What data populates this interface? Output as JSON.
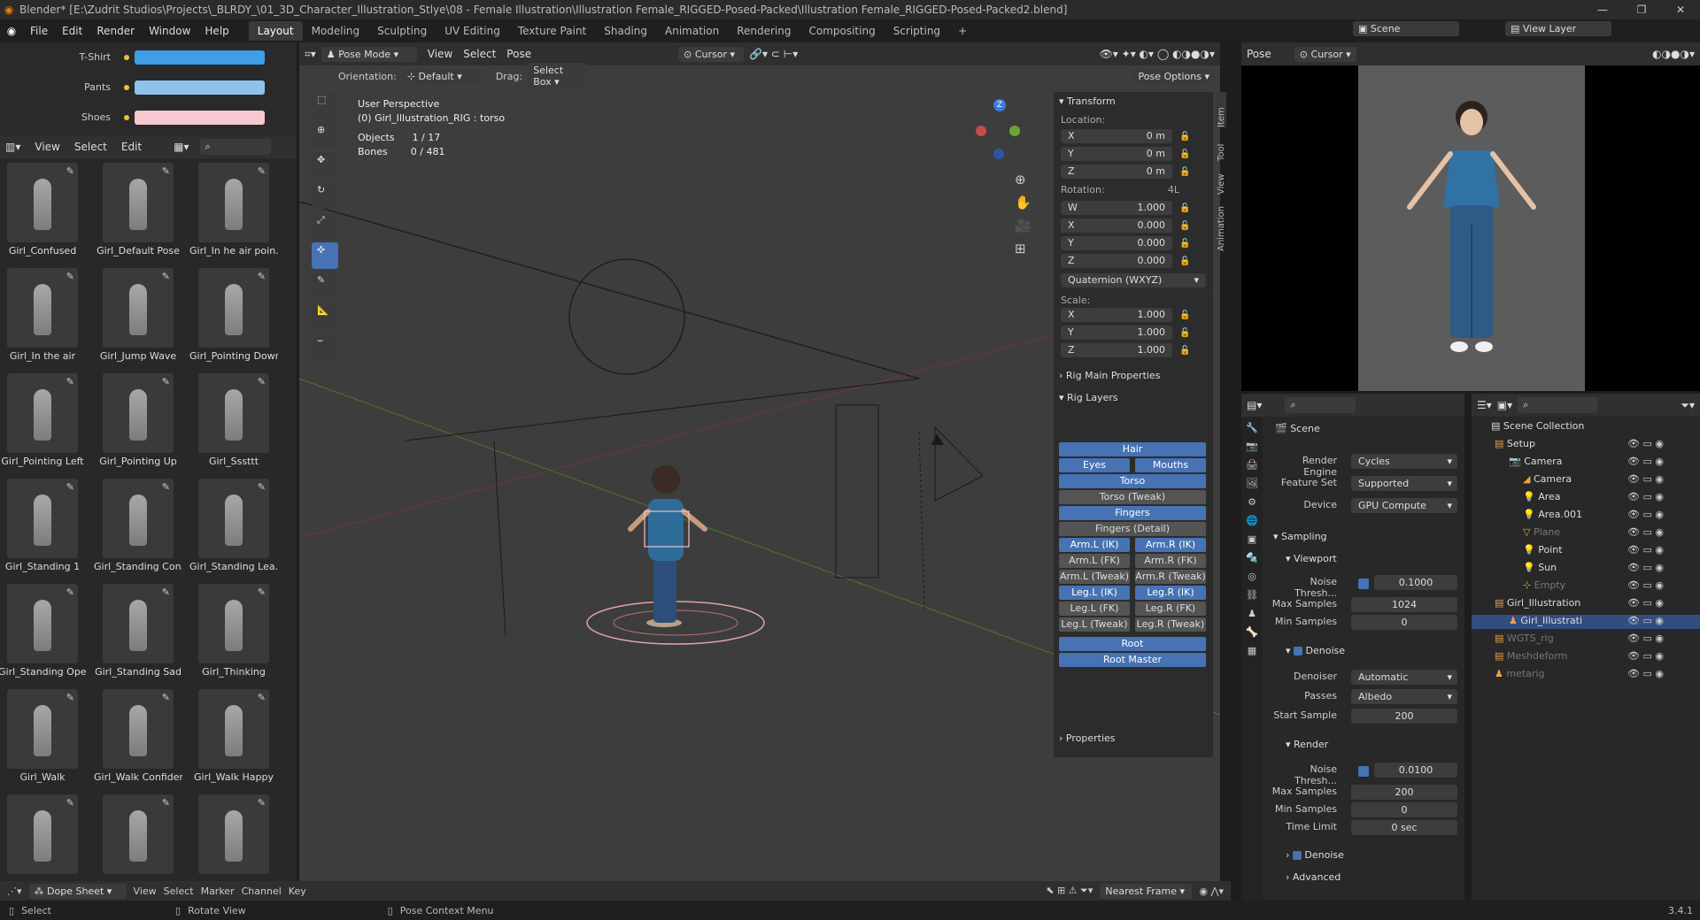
{
  "title": "Blender* [E:\\Zudrit Studios\\Projects\\_BLRDY_\\01_3D_Character_Illustration_Stlye\\08 - Female Illustration\\Illustration Female_RIGGED-Posed-Packed\\Illustration Female_RIGGED-Posed-Packed2.blend]",
  "window_controls": [
    "—",
    "❐",
    "✕"
  ],
  "menu": [
    "File",
    "Edit",
    "Render",
    "Window",
    "Help"
  ],
  "workspaces": [
    "Layout",
    "Modeling",
    "Sculpting",
    "UV Editing",
    "Texture Paint",
    "Shading",
    "Animation",
    "Rendering",
    "Compositing",
    "Scripting",
    "+"
  ],
  "top_right": {
    "scene": "Scene",
    "view_layer": "View Layer"
  },
  "colors_panel": [
    {
      "label": "T-Shirt",
      "color": "#3f9ee6"
    },
    {
      "label": "Pants",
      "color": "#8ec4ec"
    },
    {
      "label": "Shoes",
      "color": "#f6c8cf"
    }
  ],
  "pose_lib_header": {
    "view": "View",
    "select": "Select",
    "edit": "Edit"
  },
  "poses": [
    "Girl_Confused",
    "Girl_Default Pose",
    "Girl_In he air poin...",
    "Girl_In the air",
    "Girl_Jump Wave",
    "Girl_Pointing Down",
    "Girl_Pointing Left",
    "Girl_Pointing Up",
    "Girl_Sssttt",
    "Girl_Standing 1",
    "Girl_Standing Con...",
    "Girl_Standing Lea...",
    "Girl_Standing Ope...",
    "Girl_Standing Sad",
    "Girl_Thinking",
    "Girl_Walk",
    "Girl_Walk Confident",
    "Girl_Walk Happy",
    "",
    "",
    ""
  ],
  "viewport_header": {
    "mode": "Pose Mode",
    "view": "View",
    "select": "Select",
    "pose": "Pose",
    "cursor": "Cursor",
    "orientation_label": "Orientation:",
    "orientation": "Default",
    "drag_label": "Drag:",
    "drag": "Select Box",
    "pose_options": "Pose Options"
  },
  "viewport_info": {
    "perspective": "User Perspective",
    "object": "(0) Girl_Illustration_RIG : torso",
    "objects_label": "Objects",
    "objects": "1 / 17",
    "bones_label": "Bones",
    "bones": "0 / 481"
  },
  "gizmo": {
    "z": "Z"
  },
  "transform": {
    "title": "Transform",
    "location_label": "Location:",
    "location": [
      {
        "axis": "X",
        "value": "0 m"
      },
      {
        "axis": "Y",
        "value": "0 m"
      },
      {
        "axis": "Z",
        "value": "0 m"
      }
    ],
    "rotation_label": "Rotation:",
    "rotation_mode_tag": "4L",
    "rotation": [
      {
        "axis": "W",
        "value": "1.000"
      },
      {
        "axis": "X",
        "value": "0.000"
      },
      {
        "axis": "Y",
        "value": "0.000"
      },
      {
        "axis": "Z",
        "value": "0.000"
      }
    ],
    "rotation_mode": "Quaternion (WXYZ)",
    "scale_label": "Scale:",
    "scale": [
      {
        "axis": "X",
        "value": "1.000"
      },
      {
        "axis": "Y",
        "value": "1.000"
      },
      {
        "axis": "Z",
        "value": "1.000"
      }
    ]
  },
  "rig_main": "Rig Main Properties",
  "rig_layers": {
    "title": "Rig Layers",
    "buttons": [
      {
        "label": "Hair",
        "on": true,
        "span": "full"
      },
      {
        "label": "Eyes",
        "on": true,
        "span": "left"
      },
      {
        "label": "Mouths",
        "on": true,
        "span": "right"
      },
      {
        "label": "Torso",
        "on": true,
        "span": "full"
      },
      {
        "label": "Torso (Tweak)",
        "on": false,
        "span": "full"
      },
      {
        "label": "Fingers",
        "on": true,
        "span": "full"
      },
      {
        "label": "Fingers (Detail)",
        "on": false,
        "span": "full"
      },
      {
        "label": "Arm.L (IK)",
        "on": true,
        "span": "left"
      },
      {
        "label": "Arm.R (IK)",
        "on": true,
        "span": "right"
      },
      {
        "label": "Arm.L (FK)",
        "on": false,
        "span": "left"
      },
      {
        "label": "Arm.R (FK)",
        "on": false,
        "span": "right"
      },
      {
        "label": "Arm.L (Tweak)",
        "on": false,
        "span": "left"
      },
      {
        "label": "Arm.R (Tweak)",
        "on": false,
        "span": "right"
      },
      {
        "label": "Leg.L (IK)",
        "on": true,
        "span": "left"
      },
      {
        "label": "Leg.R (IK)",
        "on": true,
        "span": "right"
      },
      {
        "label": "Leg.L (FK)",
        "on": false,
        "span": "left"
      },
      {
        "label": "Leg.R (FK)",
        "on": false,
        "span": "right"
      },
      {
        "label": "Leg.L (Tweak)",
        "on": false,
        "span": "left"
      },
      {
        "label": "Leg.R (Tweak)",
        "on": false,
        "span": "right"
      },
      {
        "label": "Root",
        "on": true,
        "span": "full",
        "gap": true
      },
      {
        "label": "Root Master",
        "on": true,
        "span": "full"
      }
    ]
  },
  "properties_section": "Properties",
  "side_tabs": [
    "Item",
    "Tool",
    "View",
    "Animation"
  ],
  "render_props": {
    "scene": "Scene",
    "engine_label": "Render Engine",
    "engine": "Cycles",
    "feature_label": "Feature Set",
    "feature": "Supported",
    "device_label": "Device",
    "device": "GPU Compute",
    "sampling": "Sampling",
    "viewport": "Viewport",
    "noise_label": "Noise Thresh...",
    "v_noise": "0.1000",
    "max_label": "Max Samples",
    "v_max": "1024",
    "min_label": "Min Samples",
    "v_min": "0",
    "denoise": "Denoise",
    "denoiser_label": "Denoiser",
    "denoiser": "Automatic",
    "passes_label": "Passes",
    "passes": "Albedo",
    "start_label": "Start Sample",
    "start": "200",
    "render": "Render",
    "r_noise": "0.0100",
    "r_max": "200",
    "r_min": "0",
    "time_label": "Time Limit",
    "time": "0 sec",
    "r_denoise": "Denoise",
    "advanced": "Advanced"
  },
  "outliner": {
    "title": "Scene Collection",
    "rows": [
      {
        "label": "Setup",
        "indent": 1,
        "kind": "collection"
      },
      {
        "label": "Camera",
        "indent": 2,
        "kind": "object"
      },
      {
        "label": "Camera",
        "indent": 3,
        "kind": "data"
      },
      {
        "label": "Area",
        "indent": 3,
        "kind": "light"
      },
      {
        "label": "Area.001",
        "indent": 3,
        "kind": "light"
      },
      {
        "label": "Plane",
        "indent": 3,
        "kind": "mesh",
        "dim": true
      },
      {
        "label": "Point",
        "indent": 3,
        "kind": "light"
      },
      {
        "label": "Sun",
        "indent": 3,
        "kind": "light"
      },
      {
        "label": "Empty",
        "indent": 3,
        "kind": "empty",
        "dim": true
      },
      {
        "label": "Girl_Illustration",
        "indent": 1,
        "kind": "collection"
      },
      {
        "label": "Girl_Illustrati",
        "indent": 2,
        "kind": "armature",
        "selected": true
      },
      {
        "label": "WGTS_rig",
        "indent": 1,
        "kind": "collection",
        "dim": true
      },
      {
        "label": "Meshdeform",
        "indent": 1,
        "kind": "collection",
        "dim": true
      },
      {
        "label": "metarig",
        "indent": 1,
        "kind": "armature",
        "dim": true
      }
    ]
  },
  "dopesheet": {
    "mode": "Dope Sheet",
    "view": "View",
    "select": "Select",
    "marker": "Marker",
    "channel": "Channel",
    "key": "Key",
    "snap": "Nearest Frame"
  },
  "statusbar": {
    "select": "Select",
    "rotate": "Rotate View",
    "context": "Pose Context Menu",
    "version": "3.4.1"
  }
}
